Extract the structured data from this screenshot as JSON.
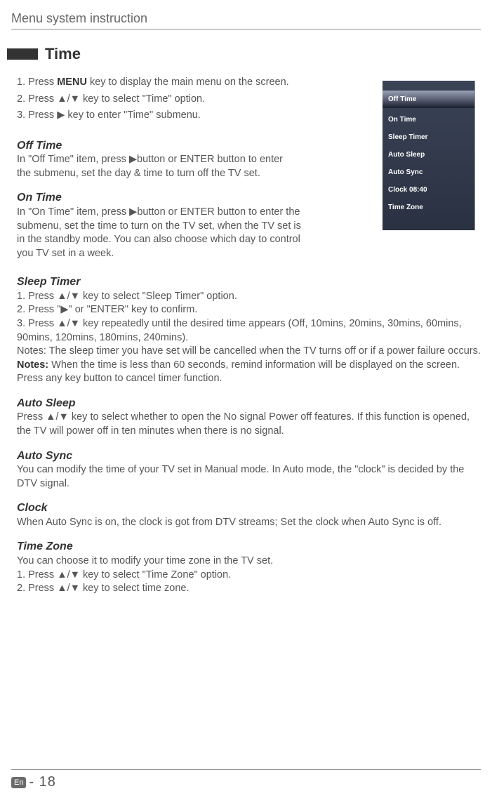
{
  "header": "Menu system instruction",
  "section_title": "Time",
  "steps": {
    "s1_a": "1. Press ",
    "s1_b": "MENU",
    "s1_c": " key to display the main menu on the screen.",
    "s2": "2. Press ▲/▼ key to select \"Time\" option.",
    "s3": "3. Press ▶ key to enter \"Time\" submenu."
  },
  "off_time": {
    "title": " Off Time",
    "body": "In \"Off Time\" item, press ▶button or ENTER  button to enter the submenu, set the day & time to turn off the TV set."
  },
  "on_time": {
    "title": "On Time",
    "body": "In \"On Time\" item, press ▶button or ENTER  button to enter the submenu, set the time to turn on the TV set, when the TV set is in the standby mode. You can also choose which day to control you TV set in a week."
  },
  "sleep_timer": {
    "title": "Sleep Timer",
    "l1": "1. Press ▲/▼ key to select \"Sleep Timer\" option.",
    "l2": "2. Press \"▶\" or \"ENTER\" key to confirm.",
    "l3": "3. Press ▲/▼ key repeatedly until the desired time appears (Off, 10mins, 20mins, 30mins, 60mins, 90mins, 120mins, 180mins, 240mins).",
    "l4": "Notes: The sleep timer you have set will be cancelled when the TV turns off or if a power failure occurs.",
    "l5a": "Notes:",
    "l5b": " When the time is less than 60 seconds, remind information will be displayed on the screen. Press any key button to cancel timer function."
  },
  "auto_sleep": {
    "title": "Auto Sleep",
    "body": "Press ▲/▼ key to select whether to open the No signal Power off features. If this function is opened, the TV will power off  in ten minutes when there is no signal."
  },
  "auto_sync": {
    "title": "Auto Sync",
    "body": "You can modify the time of your TV set in Manual mode. In Auto mode, the \"clock\" is decided by the DTV signal."
  },
  "clock": {
    "title": "Clock",
    "body": "When Auto Sync is on, the clock is got from DTV streams; Set the clock when Auto Sync is off."
  },
  "time_zone": {
    "title": "Time Zone",
    "l1": "You can choose it to modify your time zone in the TV set.",
    "l2": "1. Press ▲/▼ key to select \"Time Zone\" option.",
    "l3": "2. Press ▲/▼ key to select time zone."
  },
  "menu": {
    "items": [
      "Off Time",
      "On Time",
      "Sleep Timer",
      "Auto Sleep",
      "Auto Sync",
      "Clock 08:40",
      "Time Zone"
    ]
  },
  "footer": {
    "lang": "En",
    "page": "- 18"
  }
}
